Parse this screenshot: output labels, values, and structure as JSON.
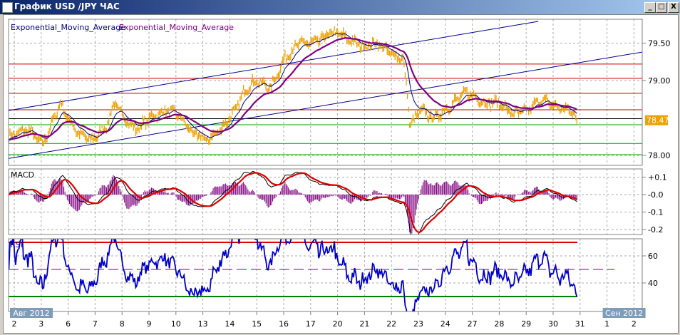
{
  "window": {
    "title": "График USD /JPY  ЧАС",
    "min_label": "_",
    "max_label": "□",
    "close_label": "X"
  },
  "legend": {
    "ema1": "Exponential_Moving_Average",
    "ema2": "Exponential_Moving_Average"
  },
  "colors": {
    "price": "#f0a000",
    "ema_fast": "#000080",
    "ema_slow": "#800080",
    "macd": "#000000",
    "signal": "#e00000",
    "hist": "#800080",
    "rsi": "#0000cc",
    "rsi_low": "#00dd00",
    "hline_red": "#c00000",
    "hline_green": "#00a000",
    "trend": "#00008b",
    "badge": "#7f9db9"
  },
  "chart_data": {
    "type": "line",
    "title": "USD/JPY ЧАС",
    "main": {
      "yticks": [
        "79.50",
        "79.00",
        "78.00"
      ],
      "ytick_values": [
        79.5,
        79.0,
        78.0
      ],
      "ylim": [
        77.9,
        79.9
      ],
      "last_price": "78.47",
      "last_value": 78.47,
      "price_anchors": [
        [
          -0.2,
          78.25
        ],
        [
          0.53,
          78.35
        ],
        [
          1.06,
          78.15
        ],
        [
          1.72,
          78.7
        ],
        [
          1.98,
          78.5
        ],
        [
          2.38,
          78.3
        ],
        [
          2.91,
          78.2
        ],
        [
          3.44,
          78.4
        ],
        [
          3.7,
          78.7
        ],
        [
          4.1,
          78.5
        ],
        [
          4.5,
          78.35
        ],
        [
          5.03,
          78.5
        ],
        [
          5.69,
          78.6
        ],
        [
          6.08,
          78.55
        ],
        [
          6.61,
          78.3
        ],
        [
          7.14,
          78.2
        ],
        [
          7.67,
          78.35
        ],
        [
          8.2,
          78.6
        ],
        [
          8.6,
          78.9
        ],
        [
          8.99,
          79.0
        ],
        [
          9.52,
          78.9
        ],
        [
          10.05,
          79.3
        ],
        [
          10.58,
          79.5
        ],
        [
          11.11,
          79.5
        ],
        [
          11.9,
          79.65
        ],
        [
          12.43,
          79.55
        ],
        [
          12.96,
          79.45
        ],
        [
          13.49,
          79.5
        ],
        [
          14.02,
          79.35
        ],
        [
          14.42,
          79.3
        ],
        [
          14.6,
          78.8
        ],
        [
          14.68,
          78.4
        ],
        [
          15.08,
          78.6
        ],
        [
          15.61,
          78.5
        ],
        [
          16.14,
          78.65
        ],
        [
          16.8,
          78.85
        ],
        [
          17.46,
          78.7
        ],
        [
          17.99,
          78.7
        ],
        [
          18.52,
          78.55
        ],
        [
          19.05,
          78.6
        ],
        [
          19.58,
          78.75
        ],
        [
          20.1,
          78.65
        ],
        [
          20.63,
          78.6
        ],
        [
          20.9,
          78.47
        ]
      ],
      "hlines_red": [
        79.22,
        79.03,
        78.83,
        78.61
      ],
      "hlines_green": [
        78.41,
        78.16,
        78.01
      ],
      "hline_black": 78.49,
      "trendlines": [
        [
          [
            -0.2,
            78.6
          ],
          [
            19.45,
            79.79
          ]
        ],
        [
          [
            -0.2,
            77.96
          ],
          [
            23.3,
            79.38
          ]
        ]
      ]
    },
    "macd": {
      "label": "MACD",
      "yticks": [
        "+0.1",
        "-0.0",
        "-0.1",
        "-0.2"
      ],
      "ytick_values": [
        0.1,
        0,
        -0.1,
        -0.2
      ],
      "ylim": [
        -0.22,
        0.15
      ]
    },
    "rsi": {
      "label": "RSI",
      "yticks": [
        "60",
        "40"
      ],
      "ytick_values": [
        60,
        40
      ],
      "levels": [
        70,
        50,
        30
      ],
      "ylim": [
        22,
        73
      ]
    },
    "xaxis": {
      "labels": [
        "2",
        "3",
        "6",
        "7",
        "8",
        "9",
        "10",
        "13",
        "14",
        "15",
        "16",
        "17",
        "20",
        "21",
        "22",
        "23",
        "24",
        "27",
        "28",
        "29",
        "30",
        "31",
        "1",
        "2"
      ],
      "months": [
        {
          "label": "Авг 2012",
          "index": 0
        },
        {
          "label": "Сен 2012",
          "index": 22
        }
      ]
    }
  }
}
